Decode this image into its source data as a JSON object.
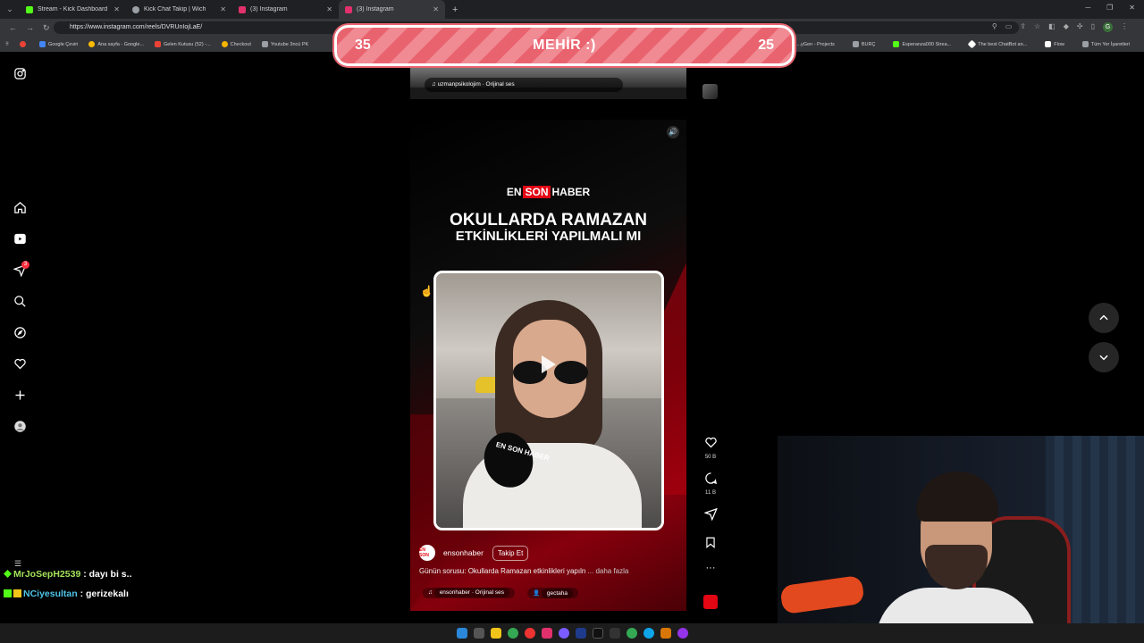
{
  "browser": {
    "tabs": [
      {
        "title": "Stream - Kick Dashboard",
        "icon": "kick-icon",
        "color": "#53fc18",
        "active": false
      },
      {
        "title": "Kick Chat Takip | Wich",
        "icon": "globe-icon",
        "color": "#9aa0a6",
        "active": false
      },
      {
        "title": "(3) Instagram",
        "icon": "instagram-icon",
        "color": "#e1306c",
        "active": false
      },
      {
        "title": "(3) Instagram",
        "icon": "instagram-icon",
        "color": "#e1306c",
        "active": true
      }
    ],
    "url": "https://www.instagram.com/reels/DVRUnIojLaE/",
    "profile_initial": "G",
    "bookmarks": [
      {
        "label": "",
        "color": "#ea4335"
      },
      {
        "label": "Google Çeviri",
        "color": "#4285f4"
      },
      {
        "label": "Ana sayfa - Google...",
        "color": "#fbbc05"
      },
      {
        "label": "Gelen Kutusu (52) -...",
        "color": "#ea4335"
      },
      {
        "label": "Checkout",
        "color": "#f4b400"
      },
      {
        "label": "Youtube 3ncü PK",
        "color": "#9aa0a6"
      }
    ],
    "bookmarks_right": [
      {
        "label": "...yGen - Projects",
        "color": "#9aa0a6"
      },
      {
        "label": "BURÇ",
        "color": "#9aa0a6"
      },
      {
        "label": "Esperanza000 Strea...",
        "color": "#53fc18"
      },
      {
        "label": "The best ChatBot an...",
        "color": "#ffffff"
      },
      {
        "label": "Flow",
        "color": "#ffffff"
      },
      {
        "label": "Tüm Yer İşaretleri",
        "color": "#9aa0a6"
      }
    ]
  },
  "banner": {
    "left_count": "35",
    "title": "MEHİR :)",
    "right_count": "25"
  },
  "sidebar": {
    "notifications_badge": "3"
  },
  "reel_above": {
    "audio": "uzmanpsikolojim · Orijinal ses"
  },
  "reel": {
    "brand": {
      "en": "EN",
      "son": "SON",
      "haber": "HABER"
    },
    "headline_line1": "OKULLARDA RAMAZAN",
    "headline_line2": "ETKİNLİKLERİ YAPILMALI MI",
    "mic_label": "EN SON HABER",
    "account": "ensonhaber",
    "avatar_text": "EN SON HABER",
    "follow_label": "Takip Et",
    "caption": "Günün sorusu: Okullarda Ramazan etkinlikleri yapıln",
    "caption_more": "... daha fazla",
    "audio": "ensonhaber · Orijinal ses",
    "tagged_user": "gectaha",
    "likes": "50 B",
    "comments": "11 B"
  },
  "chat": [
    {
      "user": "MrJoSepH2539",
      "message": ": dayı bi s.."
    },
    {
      "user": "NCiyesultan",
      "message": ": gerizekalı"
    }
  ]
}
